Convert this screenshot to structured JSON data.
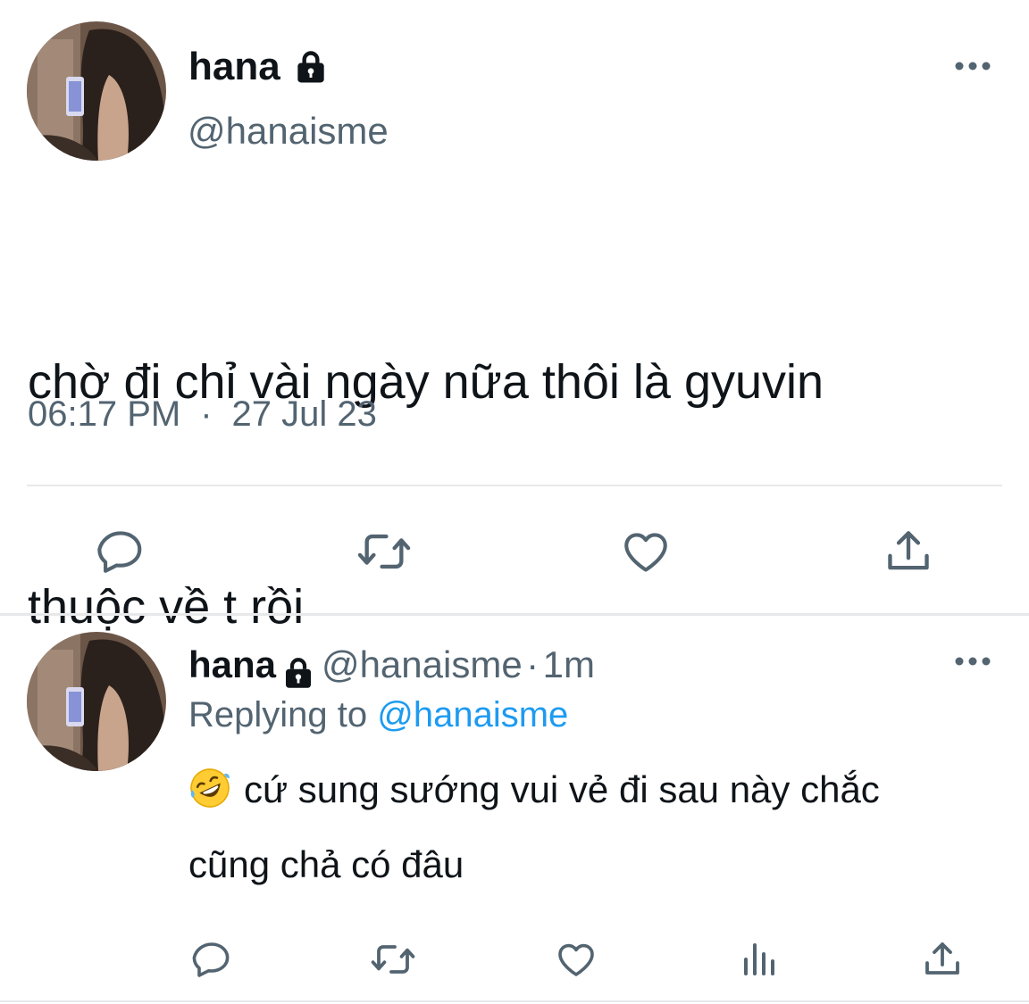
{
  "tweet": {
    "author": {
      "name": "hana",
      "handle": "@hanaisme",
      "protected_icon": "lock-icon"
    },
    "more_icon": "more-horizontal-icon",
    "text_line1": "chờ đi chỉ vài ngày nữa thôi là gyuvin",
    "text_line2": "thuộc về t rồi",
    "time": "06:17 PM",
    "separator": "·",
    "date": "27 Jul 23",
    "actions": {
      "reply_icon": "reply-icon",
      "retweet_icon": "retweet-icon",
      "like_icon": "like-icon",
      "share_icon": "share-icon"
    }
  },
  "reply": {
    "author": {
      "name": "hana",
      "handle": "@hanaisme",
      "protected_icon": "lock-icon"
    },
    "dot": "·",
    "age": "1m",
    "replying_label": "Replying to",
    "replying_to": "@hanaisme",
    "emoji": "rolling-on-floor-laughing-emoji",
    "text_line1": "cứ sung sướng vui vẻ đi sau này chắc",
    "text_line2": "cũng chả có đâu",
    "actions": {
      "reply_icon": "reply-icon",
      "retweet_icon": "retweet-icon",
      "like_icon": "like-icon",
      "views_icon": "views-icon",
      "share_icon": "share-icon"
    }
  },
  "colors": {
    "text": "#0f1419",
    "secondary": "#536471",
    "link": "#1d9bf0",
    "divider": "#e6e8ea"
  }
}
